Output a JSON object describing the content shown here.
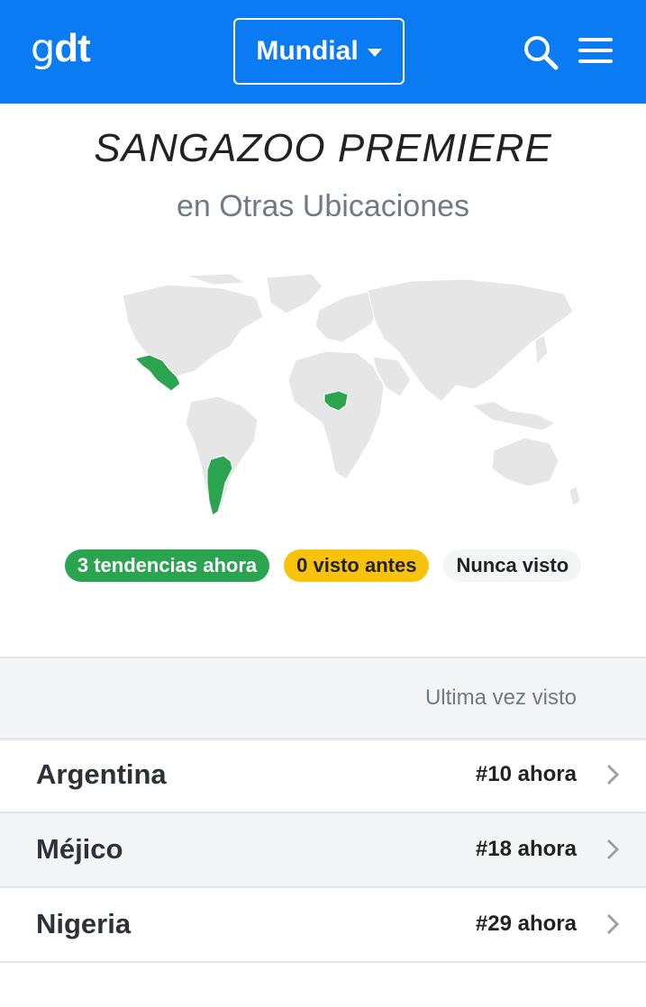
{
  "header": {
    "logo_light": "g",
    "logo_bold": "dt",
    "region_label": "Mundial"
  },
  "page": {
    "title": "SANGAZOO PREMIERE",
    "subtitle": "en Otras Ubicaciones"
  },
  "colors": {
    "brand": "#0b7bf3",
    "trending": "#2aa44f",
    "seen_before": "#f9c20b",
    "never_seen": "#f4f5f6",
    "map_land": "#e6e6e6"
  },
  "legend": {
    "trending": "3 tendencias ahora",
    "seen_before": "0 visto antes",
    "never_seen": "Nunca visto"
  },
  "list": {
    "column_header": "Ultima vez visto",
    "rows": [
      {
        "country": "Argentina",
        "rank": "#10 ahora"
      },
      {
        "country": "Méjico",
        "rank": "#18 ahora"
      },
      {
        "country": "Nigeria",
        "rank": "#29 ahora"
      }
    ]
  }
}
